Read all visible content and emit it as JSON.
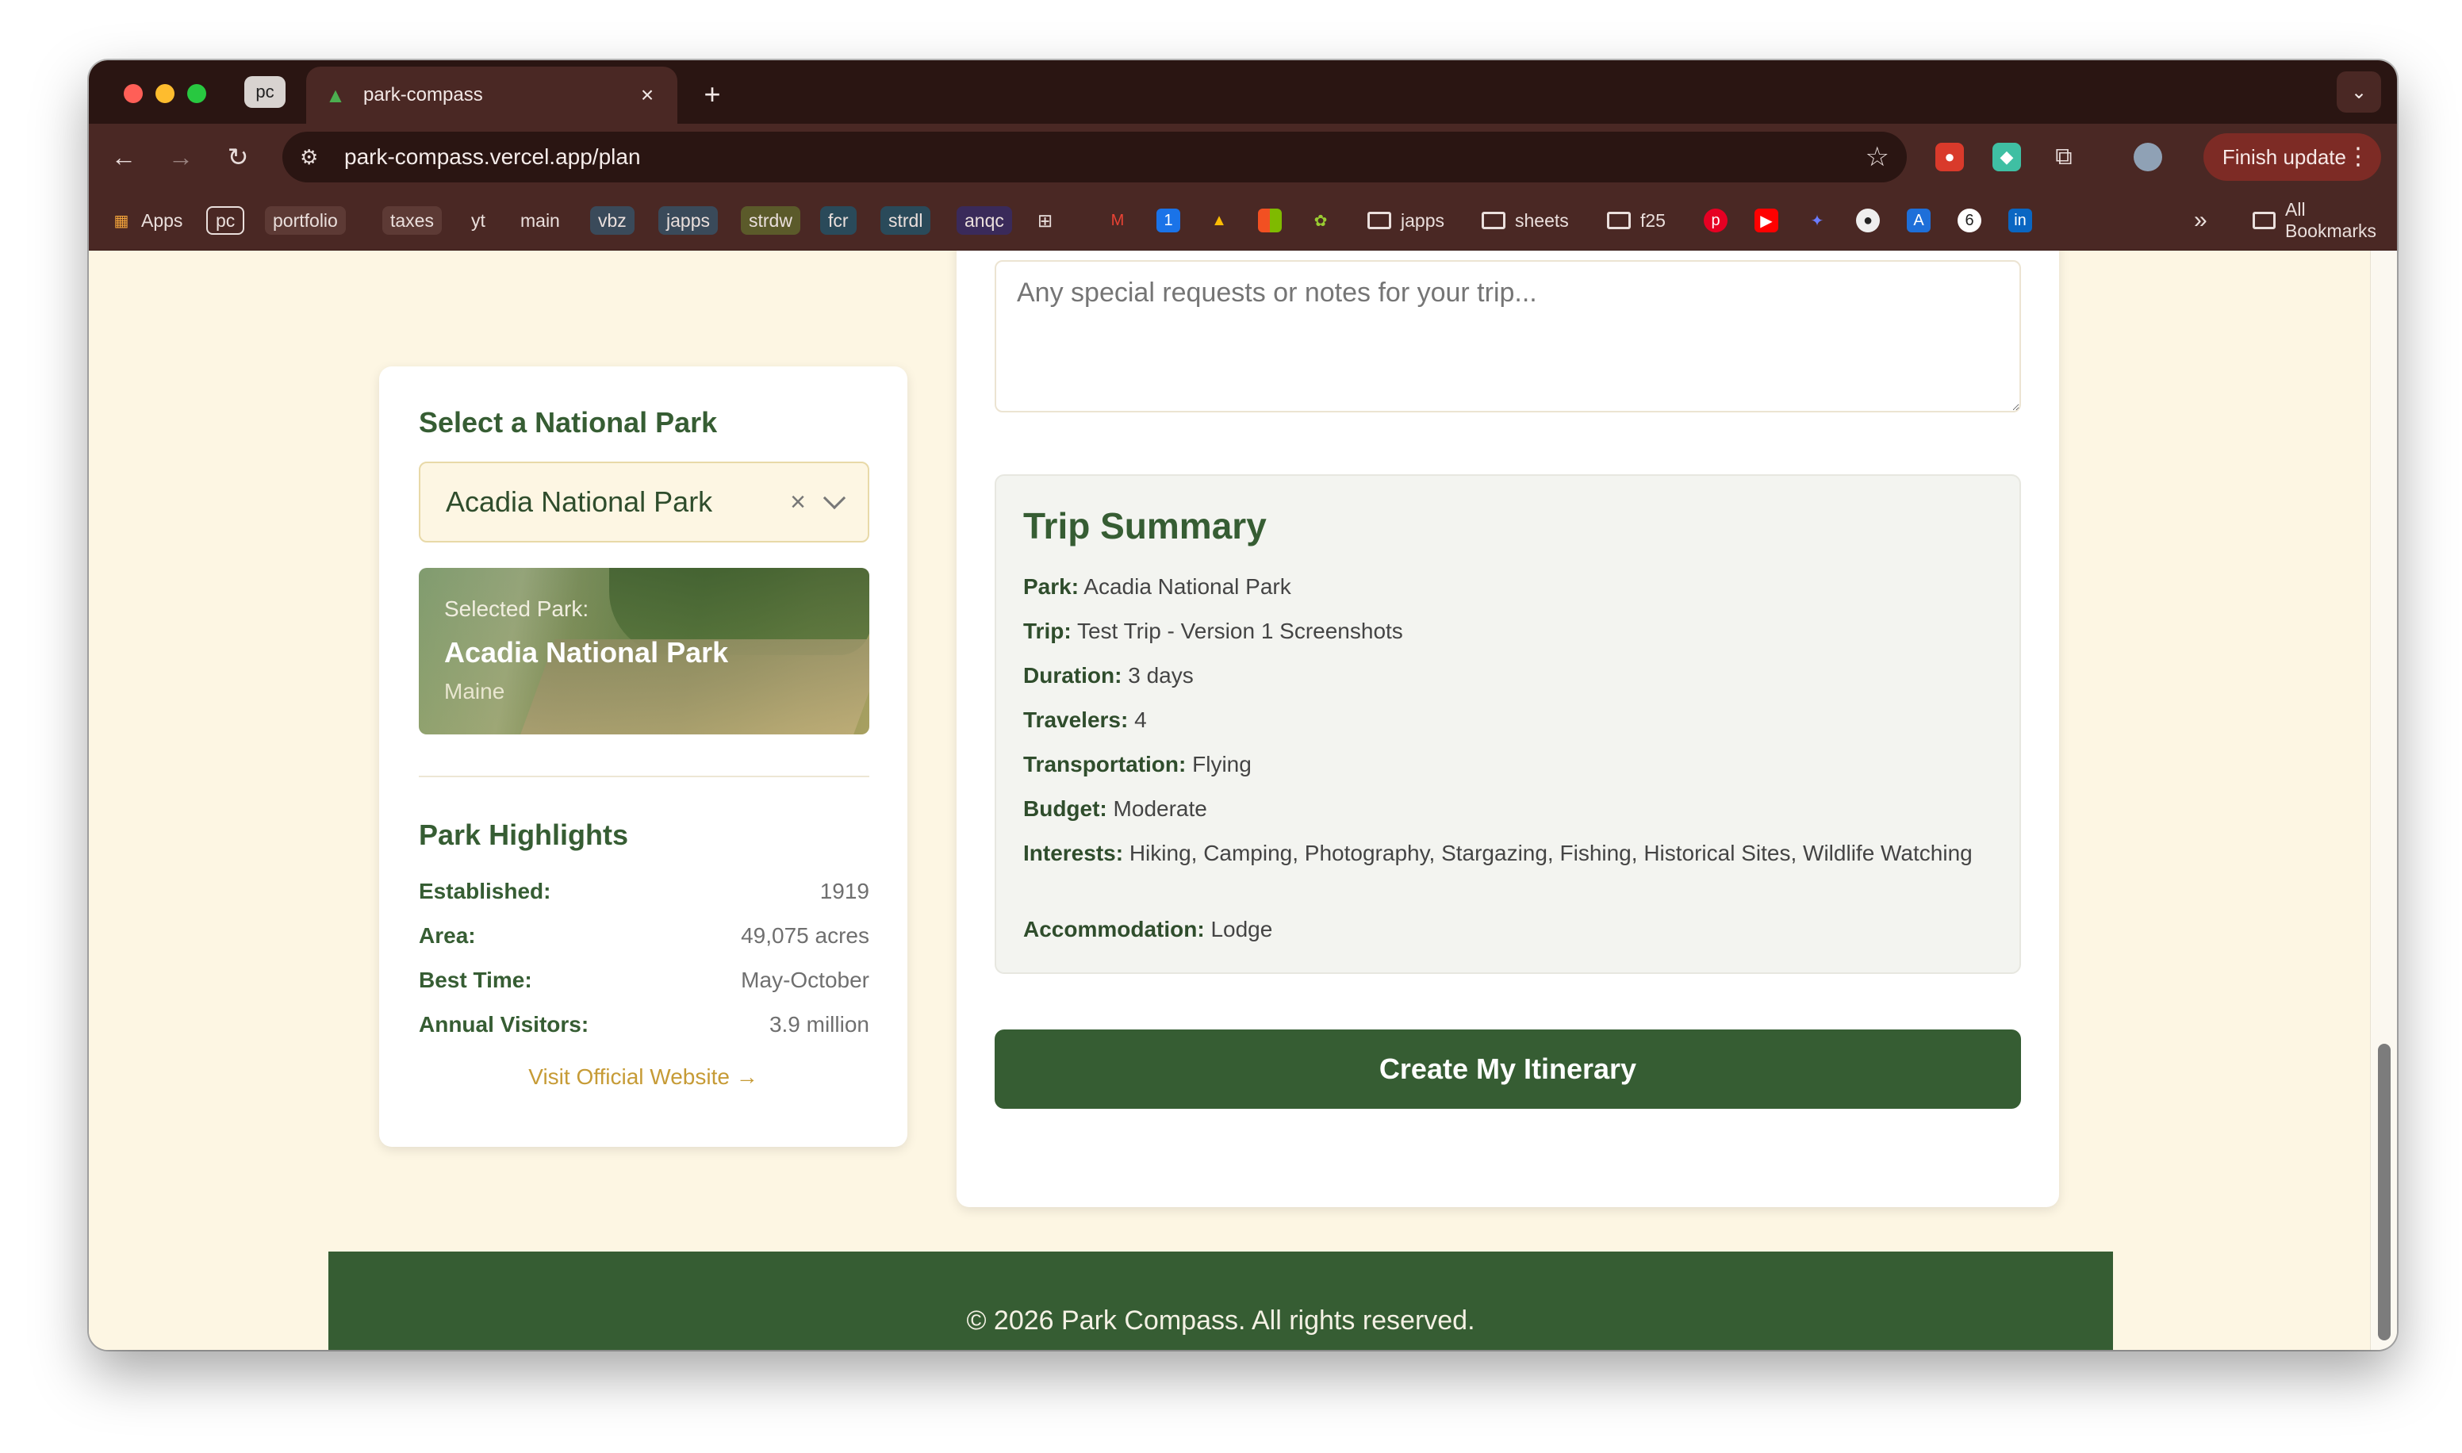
{
  "browser": {
    "pinned_tab": "pc",
    "tab_title": "park-compass",
    "url": "park-compass.vercel.app/plan",
    "finish_update": "Finish update",
    "bookmarks": [
      "Apps",
      "pc",
      "portfolio",
      "taxes",
      "yt",
      "main",
      "vbz",
      "japps",
      "strdw",
      "fcr",
      "strdl",
      "anqc",
      "japps",
      "sheets",
      "f25",
      "All Bookmarks"
    ]
  },
  "park_panel": {
    "heading": "Select a National Park",
    "selected_value": "Acadia National Park",
    "image_label": "Selected Park:",
    "image_name": "Acadia National Park",
    "image_state": "Maine",
    "highlights_heading": "Park Highlights",
    "highlights": [
      {
        "label": "Established:",
        "value": "1919"
      },
      {
        "label": "Area:",
        "value": "49,075 acres"
      },
      {
        "label": "Best Time:",
        "value": "May-October"
      },
      {
        "label": "Annual Visitors:",
        "value": "3.9 million"
      }
    ],
    "visit_link": "Visit Official Website →"
  },
  "trip_form": {
    "notes_placeholder": "Any special requests or notes for your trip...",
    "summary_title": "Trip Summary",
    "summary": [
      {
        "label": "Park:",
        "value": "Acadia National Park"
      },
      {
        "label": "Trip:",
        "value": "Test Trip - Version 1 Screenshots"
      },
      {
        "label": "Duration:",
        "value": "3 days"
      },
      {
        "label": "Travelers:",
        "value": "4"
      },
      {
        "label": "Transportation:",
        "value": "Flying"
      },
      {
        "label": "Budget:",
        "value": "Moderate"
      },
      {
        "label": "Interests:",
        "value": "Hiking, Camping, Photography, Stargazing, Fishing, Historical Sites, Wildlife Watching"
      },
      {
        "label": "Accommodation:",
        "value": "Lodge"
      }
    ],
    "create_button": "Create My Itinerary"
  },
  "footer": {
    "text": "© 2026 Park Compass. All rights reserved."
  },
  "colors": {
    "brand_green": "#365d33",
    "accent_gold": "#c69b36",
    "page_bg": "#fdf6e3",
    "browser_dark": "#2a1512",
    "browser_toolbar": "#4a2824"
  }
}
